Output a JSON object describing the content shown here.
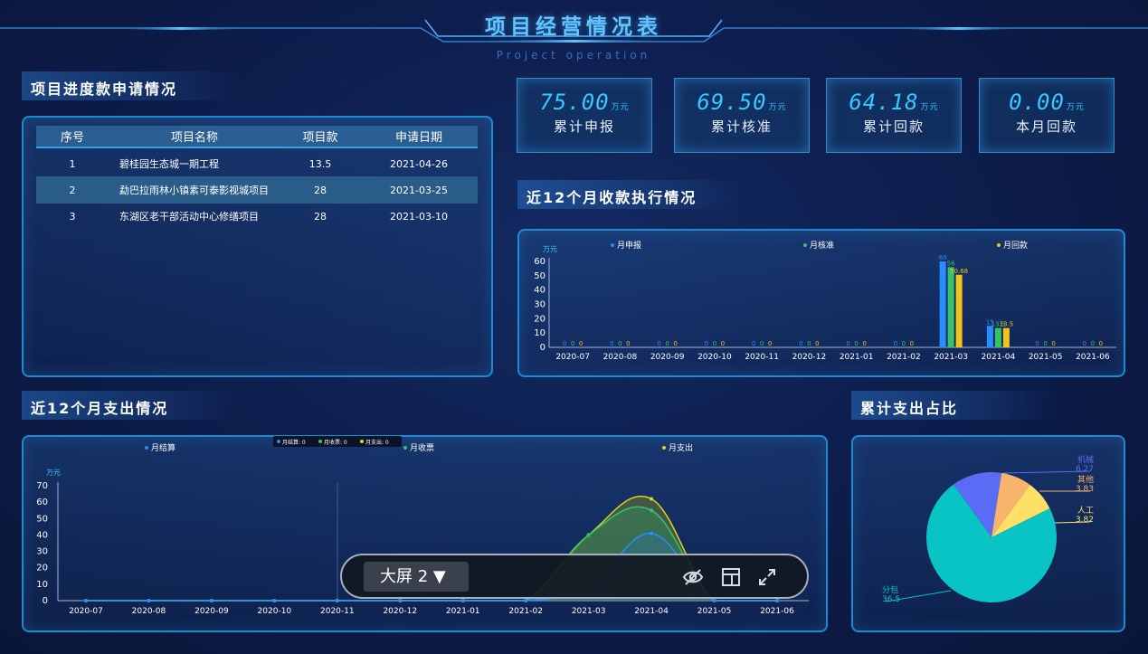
{
  "header": {
    "title": "项目经营情况表",
    "subtitle": "Project operation"
  },
  "sections": {
    "progress_requests": "项目进度款申请情况",
    "receipts_12m": "近12个月收款执行情况",
    "expenses_12m": "近12个月支出情况",
    "expense_share": "累计支出占比"
  },
  "table": {
    "headers": [
      "序号",
      "项目名称",
      "项目款",
      "申请日期"
    ],
    "rows": [
      [
        "1",
        "碧桂园生态城一期工程",
        "13.5",
        "2021-04-26"
      ],
      [
        "2",
        "勐巴拉雨林小镇素可泰影视城项目",
        "28",
        "2021-03-25"
      ],
      [
        "3",
        "东湖区老干部活动中心修缮项目",
        "28",
        "2021-03-10"
      ]
    ]
  },
  "kpis": [
    {
      "value": "75.00",
      "unit": "万元",
      "label": "累计申报"
    },
    {
      "value": "69.50",
      "unit": "万元",
      "label": "累计核准"
    },
    {
      "value": "64.18",
      "unit": "万元",
      "label": "累计回款"
    },
    {
      "value": "0.00",
      "unit": "万元",
      "label": "本月回款"
    }
  ],
  "chart_data": [
    {
      "type": "bar",
      "ylabel": "万元",
      "ylim": [
        0,
        60
      ],
      "yticks": [
        0,
        10,
        20,
        30,
        40,
        50,
        60
      ],
      "legend_position": "top",
      "categories": [
        "2020-07",
        "2020-08",
        "2020-09",
        "2020-10",
        "2020-11",
        "2020-12",
        "2021-01",
        "2021-02",
        "2021-03",
        "2021-04",
        "2021-05",
        "2021-06"
      ],
      "series": [
        {
          "name": "月申报",
          "color": "#2a8dff",
          "values": [
            0,
            0,
            0,
            0,
            0,
            0,
            0,
            0,
            60,
            15,
            0,
            0
          ]
        },
        {
          "name": "月核准",
          "color": "#33c46a",
          "values": [
            0,
            0,
            0,
            0,
            0,
            0,
            0,
            0,
            56,
            13.5,
            0,
            0
          ]
        },
        {
          "name": "月回款",
          "color": "#f2c31a",
          "values": [
            0,
            0,
            0,
            0,
            0,
            0,
            0,
            0,
            50.68,
            13.5,
            0,
            0
          ]
        }
      ]
    },
    {
      "type": "area",
      "ylabel": "万元",
      "ylim": [
        0,
        70
      ],
      "yticks": [
        0,
        10,
        20,
        30,
        40,
        50,
        60,
        70
      ],
      "legend_position": "top",
      "tooltip": [
        "月结算: 0",
        "月收票: 0",
        "月支出: 0"
      ],
      "categories": [
        "2020-07",
        "2020-08",
        "2020-09",
        "2020-10",
        "2020-11",
        "2020-12",
        "2021-01",
        "2021-02",
        "2021-03",
        "2021-04",
        "2021-05",
        "2021-06"
      ],
      "series": [
        {
          "name": "月结算",
          "color": "#2a8dff",
          "values": [
            0,
            0,
            0,
            0,
            0,
            0,
            0,
            0,
            8,
            41,
            0,
            0
          ]
        },
        {
          "name": "月收票",
          "color": "#33c46a",
          "values": [
            0,
            0,
            0,
            0,
            0,
            0,
            0,
            0,
            40,
            55,
            0,
            0
          ]
        },
        {
          "name": "月支出",
          "color": "#d8d81a",
          "values": [
            0,
            0,
            0,
            0,
            0,
            0,
            0,
            0,
            40,
            62,
            0,
            0
          ]
        }
      ]
    },
    {
      "type": "pie",
      "slices": [
        {
          "label": "机械",
          "value": 6.27,
          "color": "#5a6cf5"
        },
        {
          "label": "其他",
          "value": 3.83,
          "color": "#f7b46c"
        },
        {
          "label": "人工",
          "value": 3.82,
          "color": "#ffe066"
        },
        {
          "label": "分包",
          "value": 36.5,
          "color": "#08c4c4"
        }
      ]
    }
  ],
  "toolbar": {
    "screen_label": "大屏 2 ▼",
    "icons": [
      "eye-off-icon",
      "layout-icon",
      "fullscreen-icon"
    ]
  }
}
